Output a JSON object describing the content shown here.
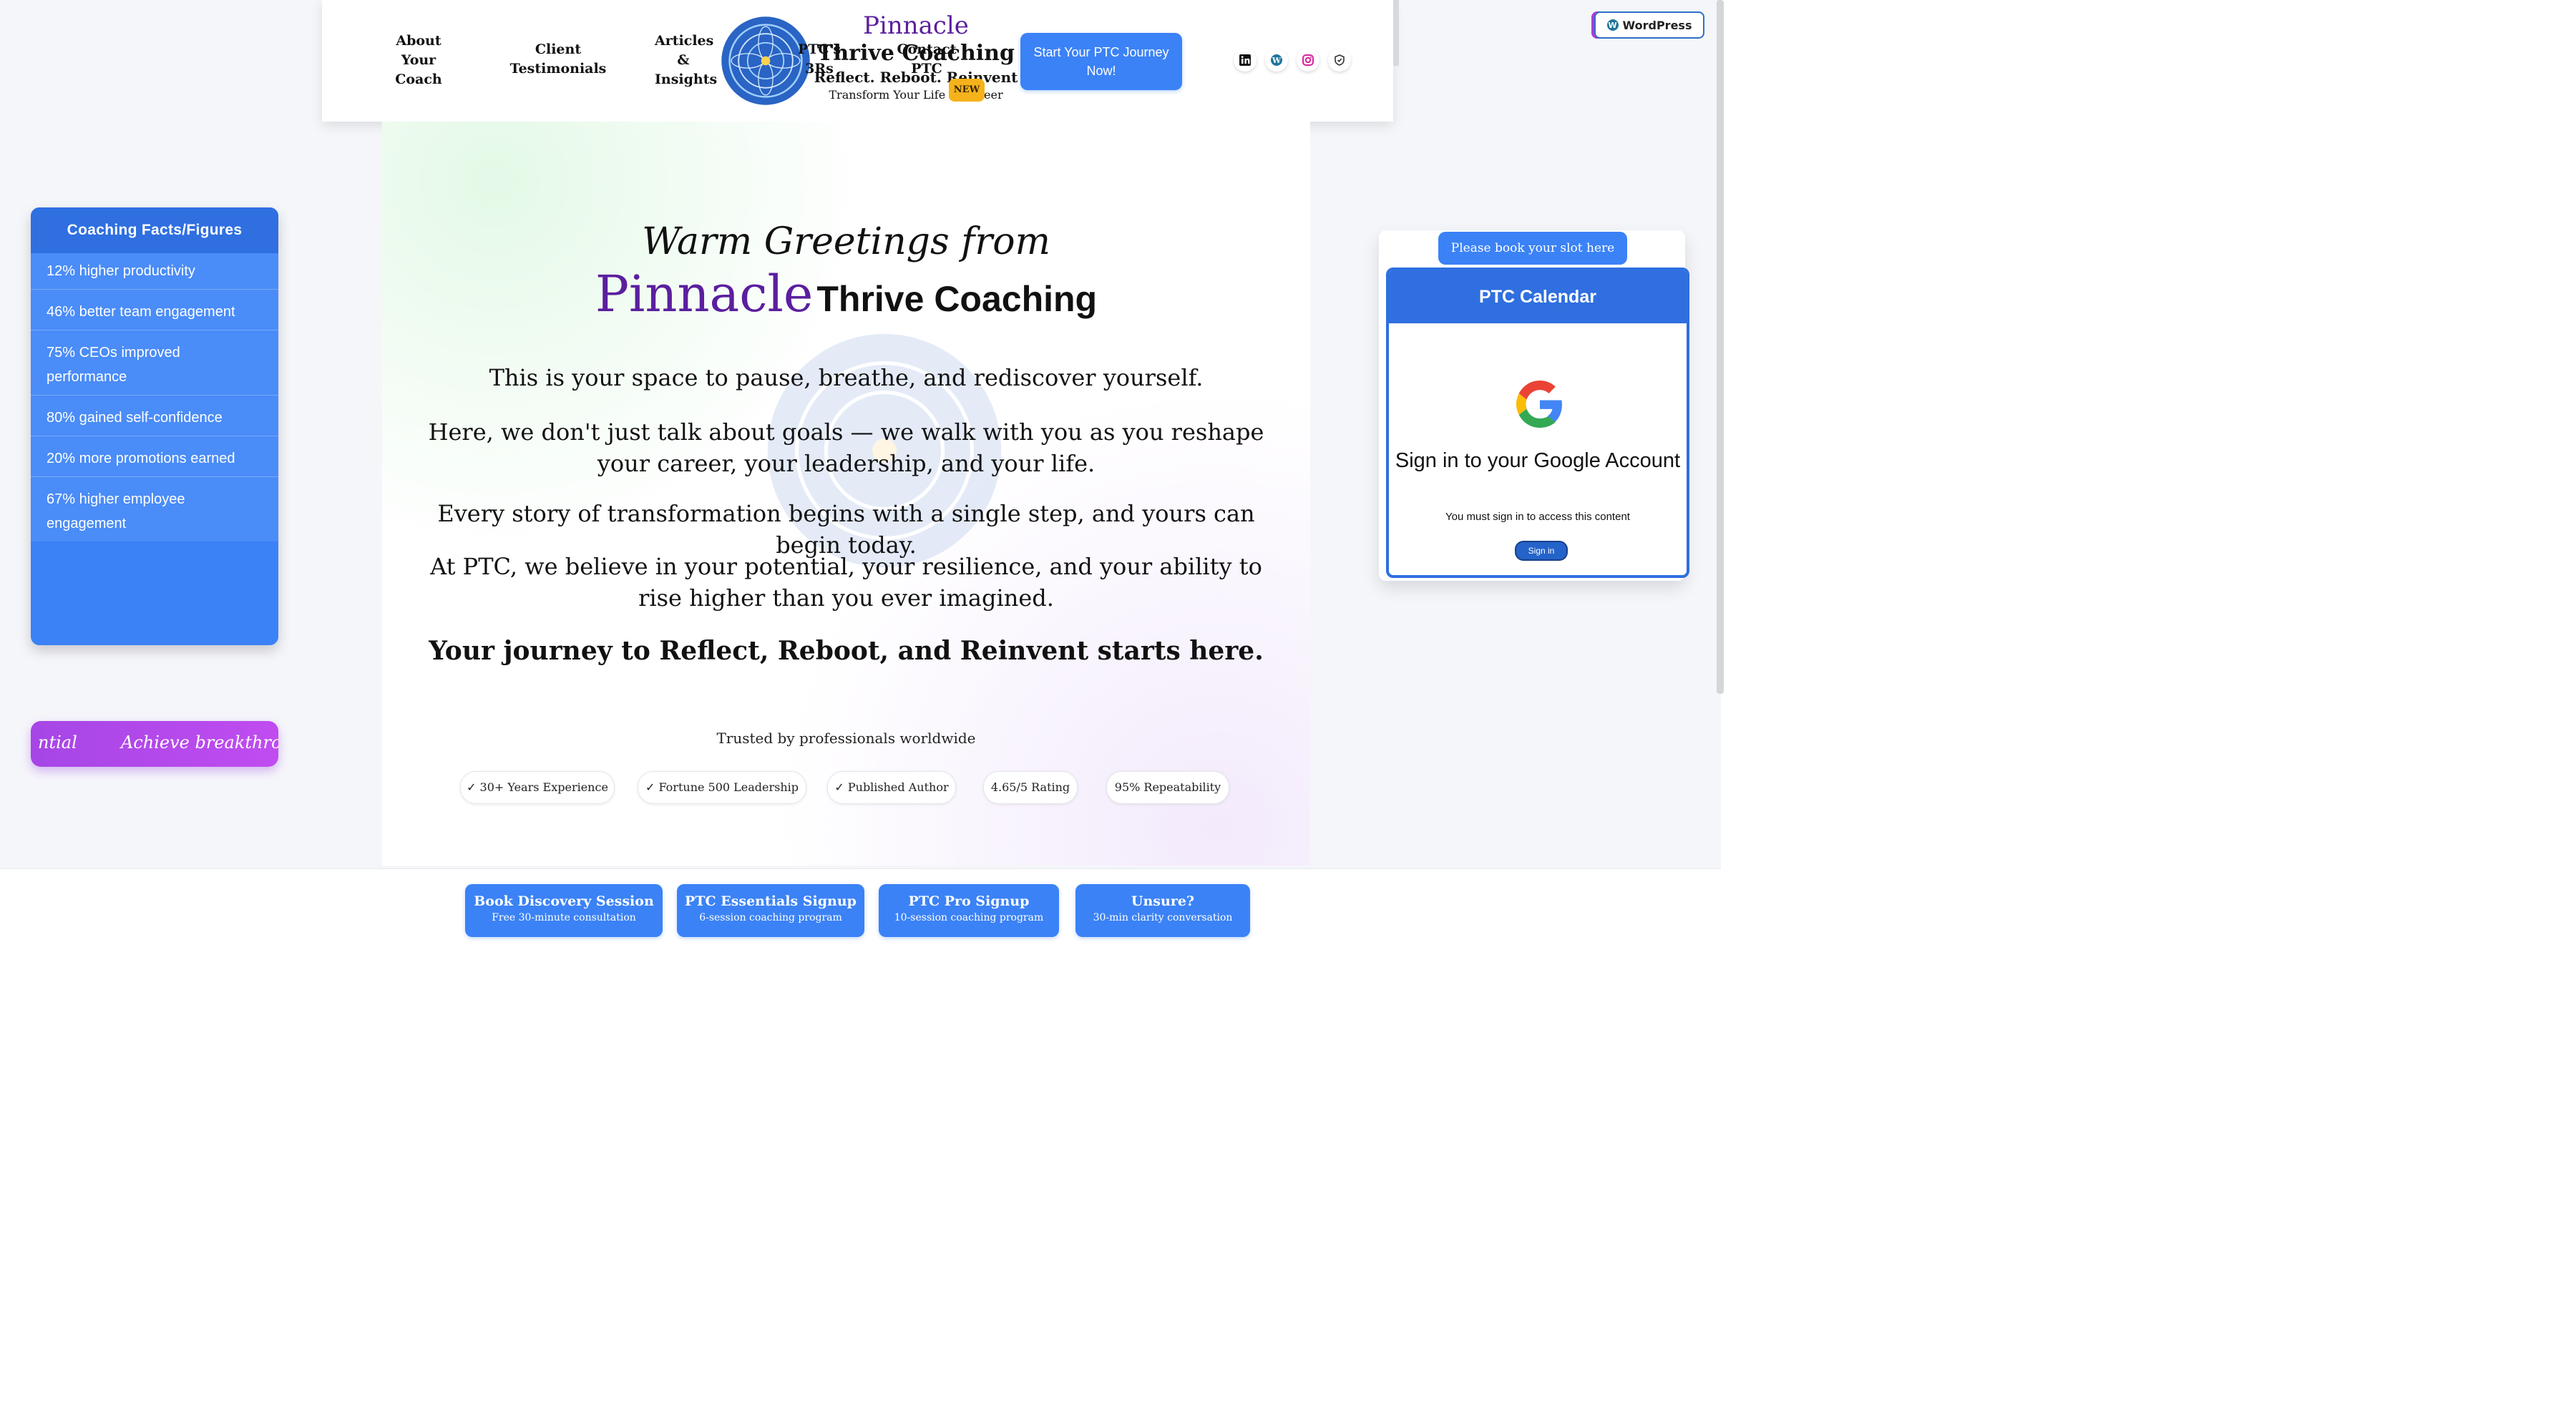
{
  "header": {
    "nav": {
      "about": "About Your Coach",
      "testimonials": "Client Testimonials",
      "articles": "Articles & Insights",
      "ptc_3rs": "PTC's 3Rs",
      "contact": "Contact PTC"
    },
    "brand": {
      "name": "Pinnacle",
      "sub": "Thrive Coaching",
      "tagline": "Reflect. Reboot. Reinvent",
      "small": "Transform Your Life & Career",
      "badge": "NEW"
    },
    "cta": "Start Your PTC Journey Now!",
    "social_icons": [
      "linkedin-icon",
      "wordpress-icon",
      "instagram-icon",
      "shield-icon"
    ]
  },
  "wordpress_badge": "WordPress",
  "facts": {
    "title": "Coaching Facts/Figures",
    "items": [
      "12% higher productivity",
      "46% better team engagement",
      "75% CEOs improved performance",
      "80% gained self-confidence",
      "20% more promotions earned",
      "67% higher employee engagement"
    ]
  },
  "marquee": {
    "text_a": "ntial",
    "text_b": "Achieve breakthroug"
  },
  "main": {
    "greeting": "Warm Greetings from",
    "title_pinnacle": "Pinnacle",
    "title_thrive": "Thrive Coaching",
    "p1": "This is your space to pause, breathe, and rediscover yourself.",
    "p2": "Here, we don't just talk about goals — we walk with you as you reshape your career, your leadership, and your life.",
    "p3": "Every story of transformation begins with a single step, and yours can begin today.",
    "p4": "At PTC, we believe in your potential, your resilience, and your ability to rise higher than you ever imagined.",
    "p5": "Your journey to Reflect, Reboot, and Reinvent starts here.",
    "trusted": "Trusted by professionals worldwide",
    "pills": [
      "✓ 30+ Years Experience",
      "✓ Fortune 500 Leadership",
      "✓ Published Author",
      "4.65/5 Rating",
      "95% Repeatability"
    ]
  },
  "bottom_buttons": [
    {
      "title": "Book Discovery Session",
      "sub": "Free 30-minute consultation"
    },
    {
      "title": "PTC Essentials Signup",
      "sub": "6-session coaching program"
    },
    {
      "title": "PTC Pro Signup",
      "sub": "10-session coaching program"
    },
    {
      "title": "Unsure?",
      "sub": "30-min clarity conversation"
    }
  ],
  "calendar": {
    "book_label": "Please book your slot here",
    "title": "PTC Calendar",
    "signin_title": "Sign in to your Google Account",
    "signin_note": "You must sign in to access this content",
    "signin_button": "Sign in"
  },
  "colors": {
    "accent": "#3b82f6",
    "brand_purple": "#5b1f9e",
    "badge_yellow": "#f5b21b",
    "marquee_purple": "#b04aec"
  }
}
